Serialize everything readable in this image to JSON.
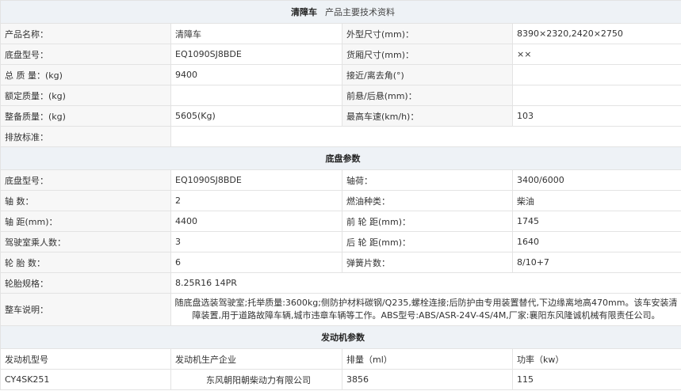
{
  "header1": {
    "title": "清障车",
    "subtitle": "产品主要技术资料"
  },
  "main": {
    "rows": [
      [
        "产品名称：",
        "清障车",
        "外型尺寸(mm)：",
        "8390×2320,2420×2750"
      ],
      [
        "底盘型号：",
        "EQ1090SJ8BDE",
        "货厢尺寸(mm)：",
        "××"
      ],
      [
        "总 质 量：(kg)",
        "9400",
        "接近/离去角(°)",
        ""
      ],
      [
        "额定质量：(kg)",
        "",
        "前悬/后悬(mm)：",
        ""
      ],
      [
        "整备质量：(kg)",
        "5605(Kg)",
        "最高车速(km/h)：",
        "103"
      ]
    ],
    "emission_label": "排放标准：",
    "emission_value": ""
  },
  "header2": {
    "title": "底盘参数"
  },
  "chassis": {
    "rows": [
      [
        "底盘型号：",
        "EQ1090SJ8BDE",
        "轴荷：",
        "3400/6000"
      ],
      [
        "轴 数：",
        "2",
        "燃油种类：",
        "柴油"
      ],
      [
        "轴 距(mm)：",
        "4400",
        "前 轮 距(mm)：",
        "1745"
      ],
      [
        "驾驶室乘人数：",
        "3",
        "后 轮 距(mm)：",
        "1640"
      ],
      [
        "轮 胎 数：",
        "6",
        "弹簧片数：",
        "8/10+7"
      ]
    ],
    "tire_label": "轮胎规格：",
    "tire_value": "8.25R16 14PR",
    "note_label": "整车说明：",
    "note_value": "随底盘选装驾驶室;托举质量:3600kg;侧防护材料碳钢/Q235,螺栓连接;后防护由专用装置替代,下边缘离地高470mm。该车安装清障装置,用于道路故障车辆,城市违章车辆等工作。ABS型号:ABS/ASR-24V-4S/4M,厂家:襄阳东风隆诚机械有限责任公司。"
  },
  "header3": {
    "title": "发动机参数"
  },
  "engine": {
    "headers": [
      "发动机型号",
      "发动机生产企业",
      "排量（ml）",
      "功率（kw）"
    ],
    "row": [
      "CY4SK251",
      "东风朝阳朝柴动力有限公司",
      "3856",
      "115"
    ]
  }
}
